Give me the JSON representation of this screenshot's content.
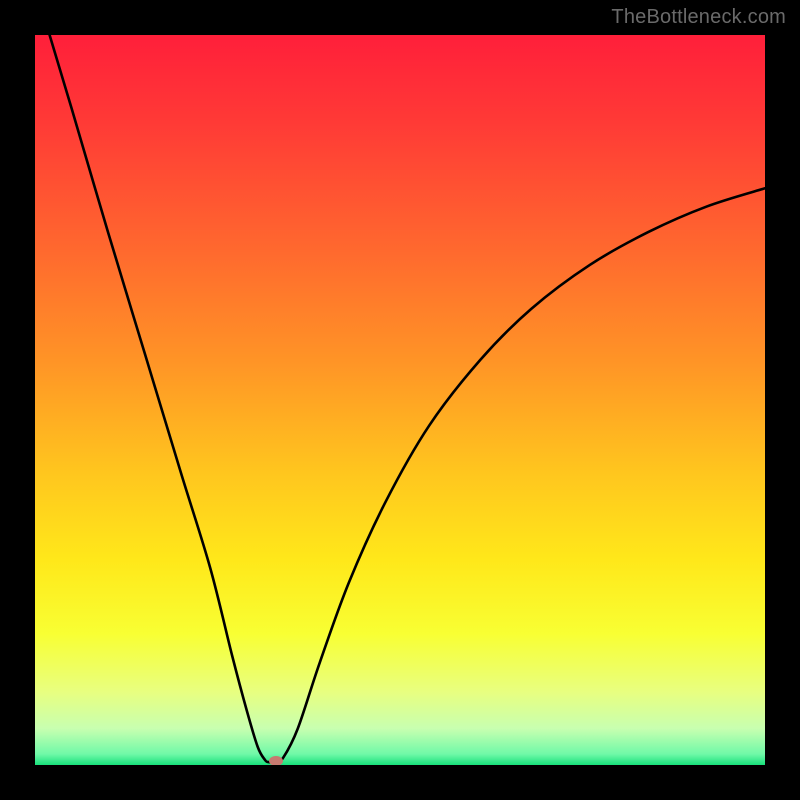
{
  "watermark": "TheBottleneck.com",
  "colors": {
    "frame": "#000000",
    "gradient_stops": [
      {
        "offset": 0.0,
        "color": "#ff1f3a"
      },
      {
        "offset": 0.12,
        "color": "#ff3a36"
      },
      {
        "offset": 0.3,
        "color": "#ff6a2e"
      },
      {
        "offset": 0.45,
        "color": "#ff9526"
      },
      {
        "offset": 0.6,
        "color": "#ffc61e"
      },
      {
        "offset": 0.72,
        "color": "#ffe81a"
      },
      {
        "offset": 0.82,
        "color": "#f8ff33"
      },
      {
        "offset": 0.9,
        "color": "#e8ff80"
      },
      {
        "offset": 0.95,
        "color": "#c8ffb0"
      },
      {
        "offset": 0.985,
        "color": "#70f9a8"
      },
      {
        "offset": 1.0,
        "color": "#18e07b"
      }
    ],
    "curve_stroke": "#000000",
    "marker_fill": "#c77a70"
  },
  "chart_data": {
    "type": "line",
    "title": "",
    "xlabel": "",
    "ylabel": "",
    "xlim": [
      0,
      100
    ],
    "ylim": [
      0,
      100
    ],
    "x_optimum": 32,
    "series": [
      {
        "name": "bottleneck-curve",
        "points": [
          {
            "x": 2.0,
            "y": 100.0
          },
          {
            "x": 5.0,
            "y": 90.0
          },
          {
            "x": 10.0,
            "y": 73.0
          },
          {
            "x": 15.0,
            "y": 56.5
          },
          {
            "x": 20.0,
            "y": 40.0
          },
          {
            "x": 24.0,
            "y": 27.0
          },
          {
            "x": 27.0,
            "y": 15.0
          },
          {
            "x": 29.0,
            "y": 7.5
          },
          {
            "x": 30.5,
            "y": 2.5
          },
          {
            "x": 31.5,
            "y": 0.7
          },
          {
            "x": 32.0,
            "y": 0.4
          },
          {
            "x": 33.0,
            "y": 0.4
          },
          {
            "x": 34.0,
            "y": 1.0
          },
          {
            "x": 36.0,
            "y": 5.0
          },
          {
            "x": 39.0,
            "y": 14.0
          },
          {
            "x": 43.0,
            "y": 25.0
          },
          {
            "x": 48.0,
            "y": 36.0
          },
          {
            "x": 54.0,
            "y": 46.5
          },
          {
            "x": 61.0,
            "y": 55.5
          },
          {
            "x": 68.0,
            "y": 62.5
          },
          {
            "x": 76.0,
            "y": 68.5
          },
          {
            "x": 84.0,
            "y": 73.0
          },
          {
            "x": 92.0,
            "y": 76.5
          },
          {
            "x": 100.0,
            "y": 79.0
          }
        ]
      }
    ],
    "marker": {
      "x": 33.0,
      "y": 0.5
    }
  }
}
